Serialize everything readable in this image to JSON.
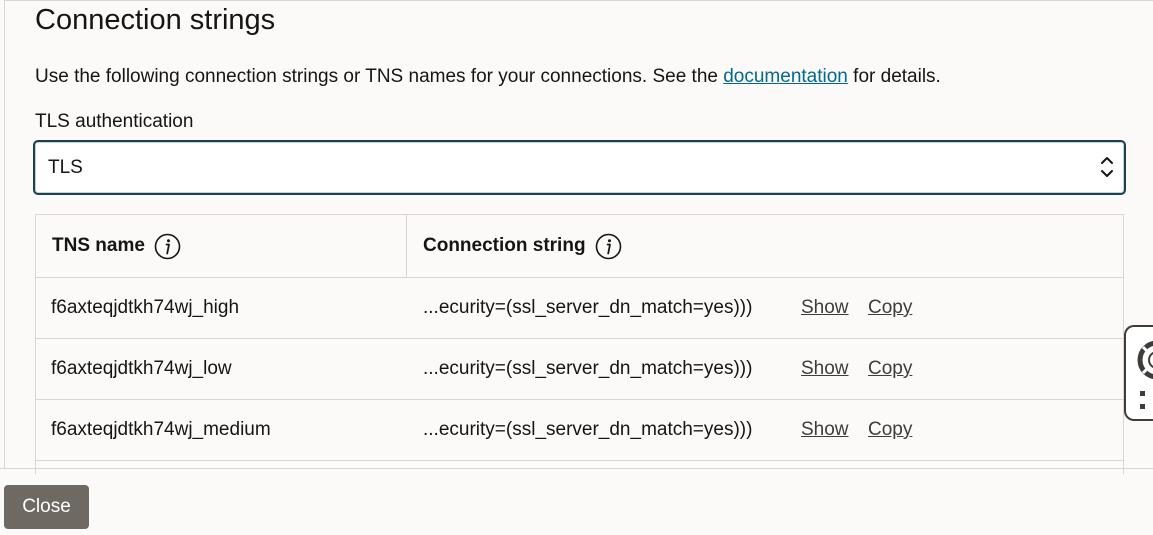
{
  "dialog": {
    "title": "Connection strings",
    "description_before": "Use the following connection strings or TNS names for your connections. See the ",
    "description_link": "documentation",
    "description_after": " for details."
  },
  "tls": {
    "label": "TLS authentication",
    "selected": "TLS"
  },
  "table": {
    "headers": {
      "tns_name": "TNS name",
      "connection_string": "Connection string"
    },
    "rows": [
      {
        "name": "f6axteqjdtkh74wj_high",
        "connection": "...ecurity=(ssl_server_dn_match=yes)))",
        "show": "Show",
        "copy": "Copy"
      },
      {
        "name": "f6axteqjdtkh74wj_low",
        "connection": "...ecurity=(ssl_server_dn_match=yes)))",
        "show": "Show",
        "copy": "Copy"
      },
      {
        "name": "f6axteqjdtkh74wj_medium",
        "connection": "...ecurity=(ssl_server_dn_match=yes)))",
        "show": "Show",
        "copy": "Copy"
      }
    ]
  },
  "footer": {
    "close_label": "Close"
  },
  "icons": {
    "info": "info-icon",
    "select_chevron": "chevron-up-down-icon",
    "help": "lifering-icon",
    "grip": "drag-handle-icon"
  },
  "colors": {
    "link": "#006b8f",
    "select_border": "#1e3f4d",
    "close_button": "#6f6964"
  }
}
